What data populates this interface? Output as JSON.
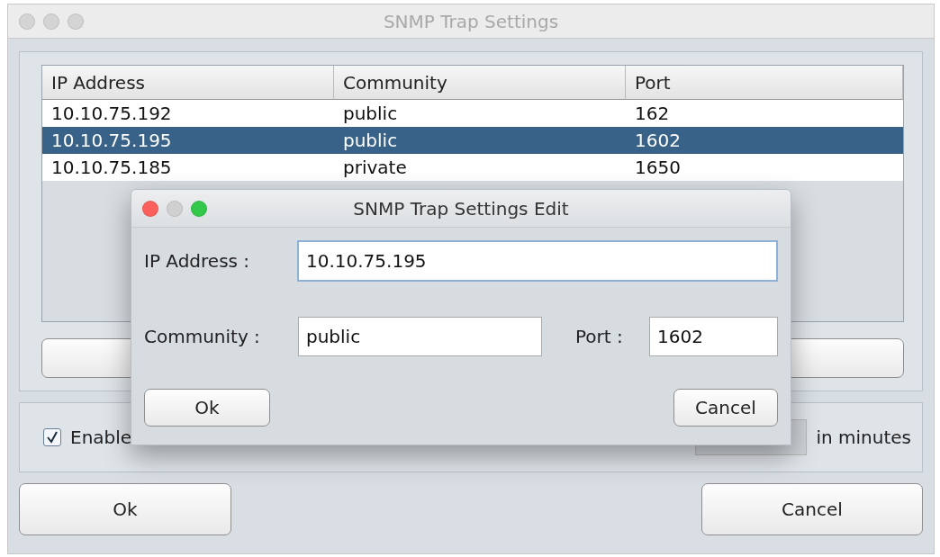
{
  "window": {
    "title": "SNMP Trap Settings"
  },
  "table": {
    "columns": [
      "IP Address",
      "Community",
      "Port"
    ],
    "rows": [
      {
        "cells": [
          "10.10.75.192",
          "public",
          "162"
        ],
        "selected": false
      },
      {
        "cells": [
          "10.10.75.195",
          "public",
          "1602"
        ],
        "selected": true
      },
      {
        "cells": [
          "10.10.75.185",
          "private",
          "1650"
        ],
        "selected": false
      }
    ]
  },
  "options": {
    "checkboxes": [
      {
        "label": "Enable",
        "checked": true
      }
    ],
    "delay_suffix": "in minutes"
  },
  "buttons": [
    "Ok",
    "Cancel"
  ],
  "dialog": {
    "title": "SNMP Trap Settings Edit",
    "ip": {
      "label": "IP Address :",
      "value": "10.10.75.195",
      "focused": true
    },
    "community": {
      "label": "Community :",
      "value": "public",
      "focused": false
    },
    "port": {
      "label": "Port :",
      "value": "1602",
      "focused": false
    },
    "buttons": [
      "Ok",
      "Cancel"
    ]
  }
}
